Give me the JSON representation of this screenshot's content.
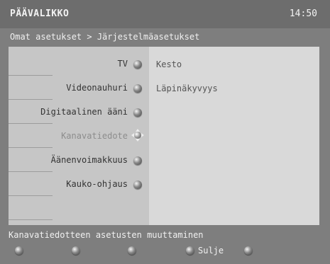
{
  "header": {
    "title": "PÄÄVALIKKO",
    "time": "14:50"
  },
  "breadcrumb": "Omat asetukset > Järjestelmäasetukset",
  "menu": {
    "items": [
      {
        "label": "TV"
      },
      {
        "label": "Videonauhuri"
      },
      {
        "label": "Digitaalinen ääni"
      },
      {
        "label": "Kanavatiedote"
      },
      {
        "label": "Äänenvoimakkuus"
      },
      {
        "label": "Kauko-ohjaus"
      }
    ]
  },
  "options": {
    "items": [
      {
        "label": "Kesto"
      },
      {
        "label": "Läpinäkyvyys"
      }
    ]
  },
  "footer": {
    "hint": "Kanavatiedotteen asetusten muuttaminen",
    "buttons": [
      {
        "label": ""
      },
      {
        "label": ""
      },
      {
        "label": ""
      },
      {
        "label": "Sulje"
      },
      {
        "label": ""
      }
    ]
  }
}
